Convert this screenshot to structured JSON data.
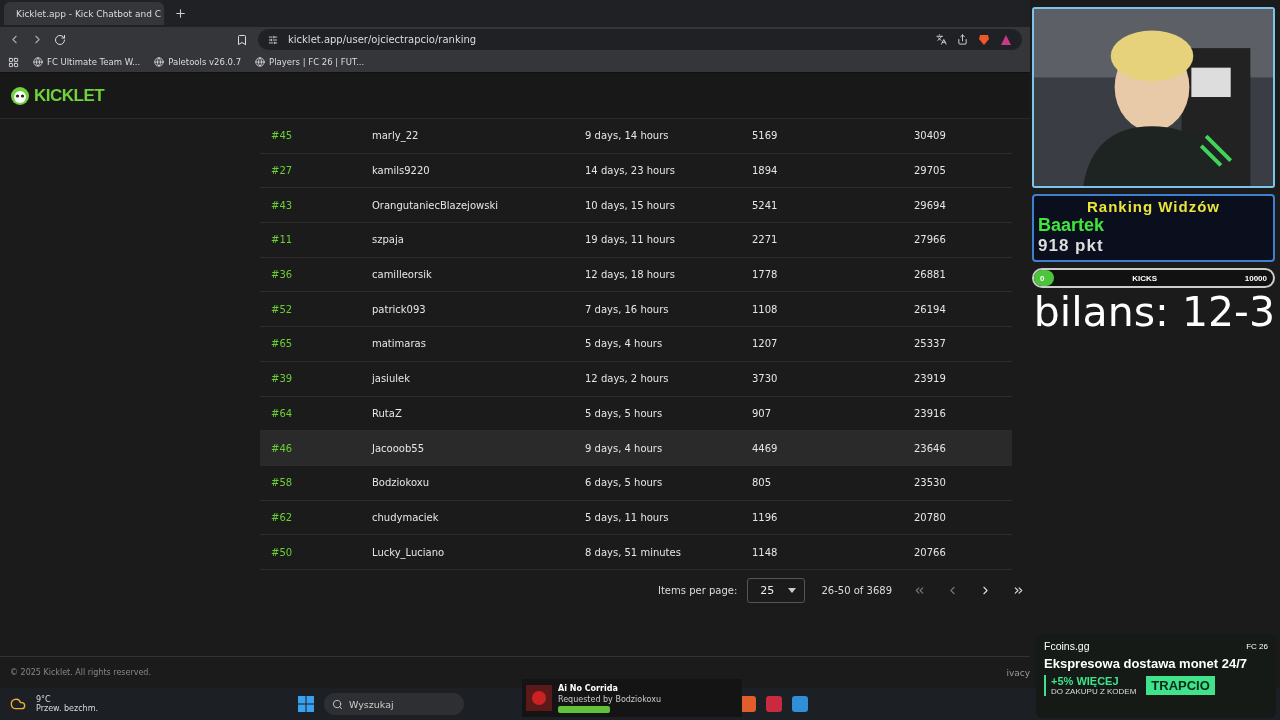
{
  "browser": {
    "tab": {
      "title": "Kicklet.app - Kick Chatbot and C",
      "selected": true
    },
    "address": "kicklet.app/user/ojciectrapcio/ranking",
    "bookmarks": [
      "FC Ultimate Team W...",
      "Paletools v26.0.7",
      "Players | FC 26 | FUT..."
    ]
  },
  "site": {
    "logo": "KICKLET",
    "footer": "© 2025 Kicklet. All rights reserved.",
    "footer_link": "ivacy"
  },
  "table": {
    "rows": [
      {
        "cells": [
          "#45",
          "marly_22",
          "9 days, 14 hours",
          "5169",
          "30409"
        ],
        "highlighted": false
      },
      {
        "cells": [
          "#27",
          "kamils9220",
          "14 days, 23 hours",
          "1894",
          "29705"
        ],
        "highlighted": false
      },
      {
        "cells": [
          "#43",
          "OrangutaniecBlazejowski",
          "10 days, 15 hours",
          "5241",
          "29694"
        ],
        "highlighted": false
      },
      {
        "cells": [
          "#11",
          "szpaja",
          "19 days, 11 hours",
          "2271",
          "27966"
        ],
        "highlighted": false
      },
      {
        "cells": [
          "#36",
          "camilleorsik",
          "12 days, 18 hours",
          "1778",
          "26881"
        ],
        "highlighted": false
      },
      {
        "cells": [
          "#52",
          "patrick093",
          "7 days, 16 hours",
          "1108",
          "26194"
        ],
        "highlighted": false
      },
      {
        "cells": [
          "#65",
          "matimaras",
          "5 days, 4 hours",
          "1207",
          "25337"
        ],
        "highlighted": false
      },
      {
        "cells": [
          "#39",
          "jasiulek",
          "12 days, 2 hours",
          "3730",
          "23919"
        ],
        "highlighted": false
      },
      {
        "cells": [
          "#64",
          "RutaZ",
          "5 days, 5 hours",
          "907",
          "23916"
        ],
        "highlighted": false
      },
      {
        "cells": [
          "#46",
          "Jacooob55",
          "9 days, 4 hours",
          "4469",
          "23646"
        ],
        "highlighted": true
      },
      {
        "cells": [
          "#58",
          "Bodziokoxu",
          "6 days, 5 hours",
          "805",
          "23530"
        ],
        "highlighted": false
      },
      {
        "cells": [
          "#62",
          "chudymaciek",
          "5 days, 11 hours",
          "1196",
          "20780"
        ],
        "highlighted": false
      },
      {
        "cells": [
          "#50",
          "Lucky_Luciano",
          "8 days, 51 minutes",
          "1148",
          "20766"
        ],
        "highlighted": false
      }
    ]
  },
  "pagination": {
    "label": "Items per page:",
    "per_page": "25",
    "range": "26-50 of 3689"
  },
  "overlay": {
    "ranking": {
      "title": "Ranking Widzów",
      "name": "Baartek",
      "points": "918 pkt"
    },
    "kicks": {
      "min": "0",
      "label": "KICKS",
      "max": "10000",
      "level": 0
    },
    "score": "bilans: 12-3"
  },
  "now_playing": {
    "title": "Ai No Corrida",
    "subtitle": "Requested by Bodziokoxu"
  },
  "ad": {
    "brand": "Fcoins.gg",
    "game": "FC 26",
    "headline": "Ekspresowa dostawa monet 24/7",
    "bonus": "+5% WIĘCEJ",
    "bonus_note": "DO ZAKUPU Z KODEM",
    "code": "TRAPCIO"
  },
  "taskbar": {
    "weather_temp": "9°C",
    "weather_desc": "Przew. bezchm.",
    "search_placeholder": "Wyszukaj"
  }
}
